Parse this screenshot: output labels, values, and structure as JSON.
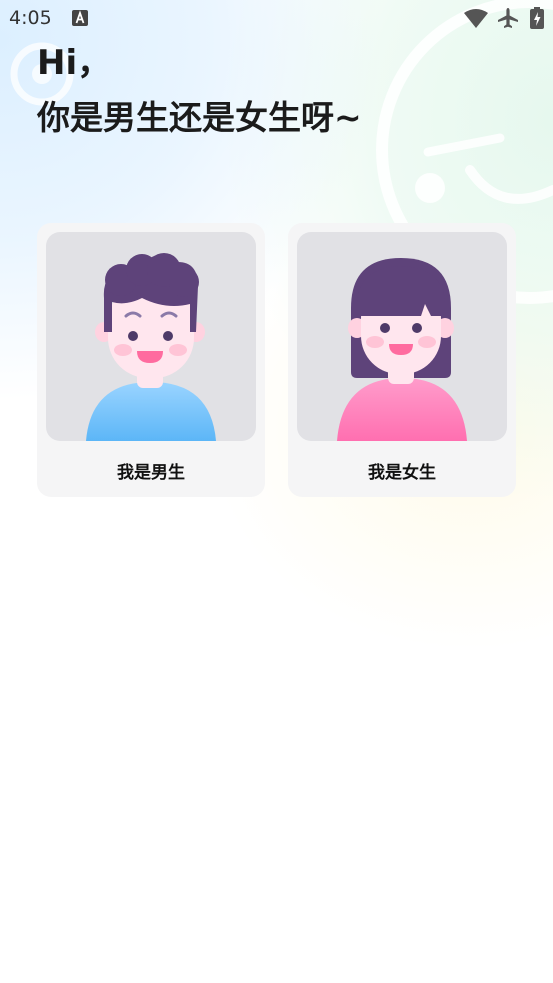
{
  "status_bar": {
    "time": "4:05",
    "icons": [
      "text-input-a-icon",
      "wifi-icon",
      "airplane-mode-icon",
      "battery-charging-icon"
    ]
  },
  "header": {
    "greeting": "Hi，",
    "question": "你是男生还是女生呀~"
  },
  "options": [
    {
      "label": "我是男生",
      "avatar": "boy-avatar",
      "shirt_color": "#74c3fb"
    },
    {
      "label": "我是女生",
      "avatar": "girl-avatar",
      "shirt_color": "#ff78b6"
    }
  ],
  "colors": {
    "hair": "#5e437a",
    "skin": "#ffe6ee",
    "card_bg": "#f5f5f6",
    "avatar_bg": "#e1e1e5"
  }
}
